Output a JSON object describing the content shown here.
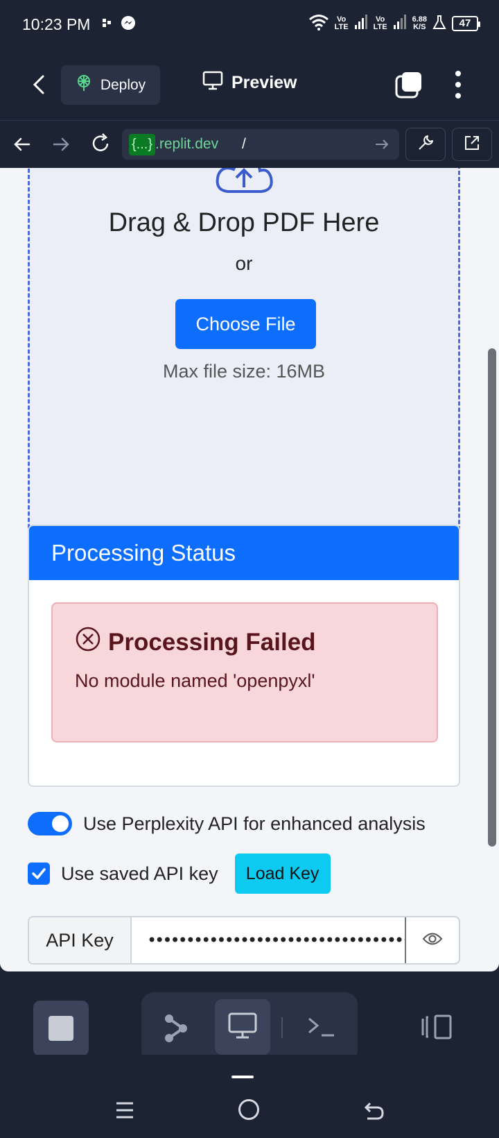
{
  "status_bar": {
    "time": "10:23 PM",
    "net1": "Vo\nLTE",
    "net2": "Vo\nLTE",
    "speed_value": "6.88",
    "speed_unit": "K/S",
    "battery": "47"
  },
  "header": {
    "deploy_label": "Deploy",
    "preview_label": "Preview"
  },
  "url_bar": {
    "badge": "{...}",
    "host": ".replit.dev",
    "path": "/"
  },
  "upload": {
    "title": "Drag & Drop PDF Here",
    "or": "or",
    "choose_label": "Choose File",
    "max_size": "Max file size: 16MB"
  },
  "status_card": {
    "header": "Processing Status",
    "alert_title": "Processing Failed",
    "alert_message": "No module named 'openpyxl'"
  },
  "options": {
    "perplexity_label": "Use Perplexity API for enhanced analysis",
    "perplexity_enabled": true,
    "saved_key_label": "Use saved API key",
    "saved_key_checked": true,
    "load_key_label": "Load Key"
  },
  "api_key": {
    "label": "API Key",
    "value": "••••••••••••••••••••••••••••••••••••••"
  },
  "colors": {
    "primary": "#0d6efd",
    "info": "#0dcaf0",
    "danger_bg": "#f8d7da",
    "danger_text": "#58151c",
    "dark_bg": "#1c2333"
  }
}
